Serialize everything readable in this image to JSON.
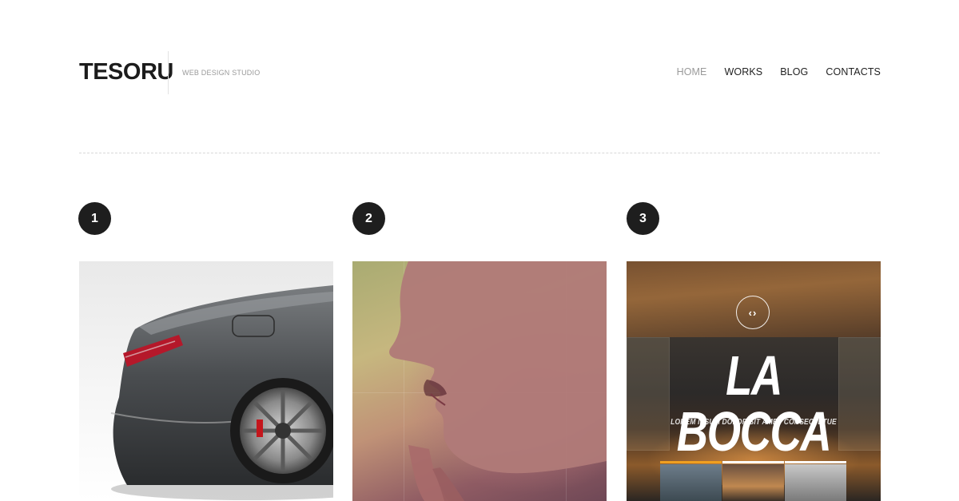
{
  "header": {
    "logo": "TESORU",
    "tagline": "WEB DESIGN STUDIO",
    "nav": [
      {
        "label": "HOME",
        "active": true
      },
      {
        "label": "WORKS",
        "active": false
      },
      {
        "label": "BLOG",
        "active": false
      },
      {
        "label": "CONTACTS",
        "active": false
      }
    ]
  },
  "portfolio": {
    "items": [
      {
        "number": "1",
        "image": "car-image"
      },
      {
        "number": "2",
        "image": "face-image"
      },
      {
        "number": "3",
        "image": "la-bocca-image",
        "title": "LA BOCCA",
        "subtitle": "LOREM IPSUM DOLOR SIT AMET CONSECTETUE",
        "icon": "code-icon"
      }
    ]
  },
  "colors": {
    "accent": "#f0a020",
    "badge": "#1e1e1e",
    "nav_active": "#9a9a9a"
  }
}
